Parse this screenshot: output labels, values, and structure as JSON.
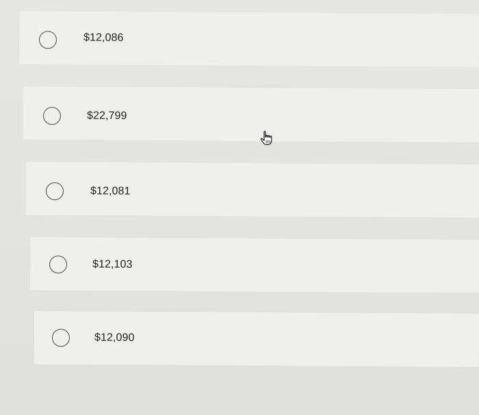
{
  "question": {
    "options": [
      {
        "label": "$12,086",
        "selected": false
      },
      {
        "label": "$22,799",
        "selected": false
      },
      {
        "label": "$12,081",
        "selected": false
      },
      {
        "label": "$12,103",
        "selected": false
      },
      {
        "label": "$12,090",
        "selected": false
      }
    ]
  },
  "icons": {
    "radio": "radio-unchecked-icon",
    "cursor": "hand-pointer-cursor-icon"
  },
  "colors": {
    "background": "#e4e4e2",
    "row_background": "#efefed",
    "radio_border": "#4a4a4a",
    "text": "#1f1f1f"
  }
}
